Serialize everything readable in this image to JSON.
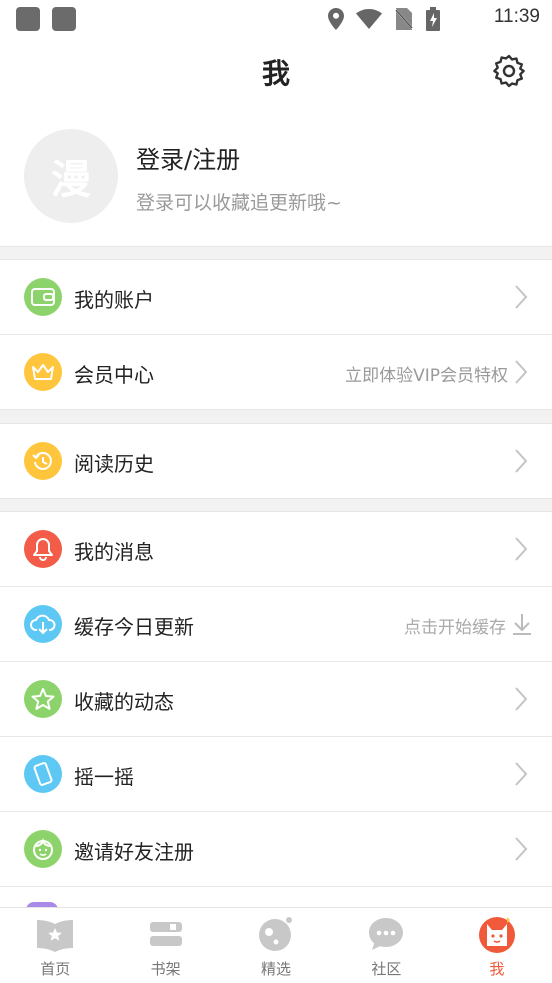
{
  "status_bar": {
    "time": "11:39"
  },
  "header": {
    "title": "我",
    "settings_icon": "gear-icon"
  },
  "profile": {
    "avatar_glyph": "漫",
    "login_label": "登录/注册",
    "subtitle": "登录可以收藏追更新哦~"
  },
  "menu": [
    {
      "label": "我的账户",
      "icon": "wallet-icon",
      "color": "#8dd36b",
      "hint": ""
    },
    {
      "label": "会员中心",
      "icon": "crown-icon",
      "color": "#ffc53d",
      "hint": "立即体验VIP会员特权"
    },
    {
      "label": "阅读历史",
      "icon": "history-icon",
      "color": "#ffc53d",
      "hint": ""
    },
    {
      "label": "我的消息",
      "icon": "bell-icon",
      "color": "#f25c48",
      "hint": ""
    },
    {
      "label": "缓存今日更新",
      "icon": "cloud-download-icon",
      "color": "#5ec8f5",
      "hint": "点击开始缓存"
    },
    {
      "label": "收藏的动态",
      "icon": "star-icon",
      "color": "#8dd36b",
      "hint": ""
    },
    {
      "label": "摇一摇",
      "icon": "phone-shake-icon",
      "color": "#5ec8f5",
      "hint": ""
    },
    {
      "label": "邀请好友注册",
      "icon": "friend-face-icon",
      "color": "#8dd36b",
      "hint": ""
    }
  ],
  "bottom_nav": {
    "tabs": [
      {
        "label": "首页",
        "icon": "home-book-icon"
      },
      {
        "label": "书架",
        "icon": "bookshelf-icon"
      },
      {
        "label": "精选",
        "icon": "featured-icon"
      },
      {
        "label": "社区",
        "icon": "chat-bubble-icon"
      },
      {
        "label": "我",
        "icon": "me-cat-icon",
        "active": true
      }
    ],
    "inactive_color": "#c8c8c8",
    "active_color": "#f05a3a"
  }
}
